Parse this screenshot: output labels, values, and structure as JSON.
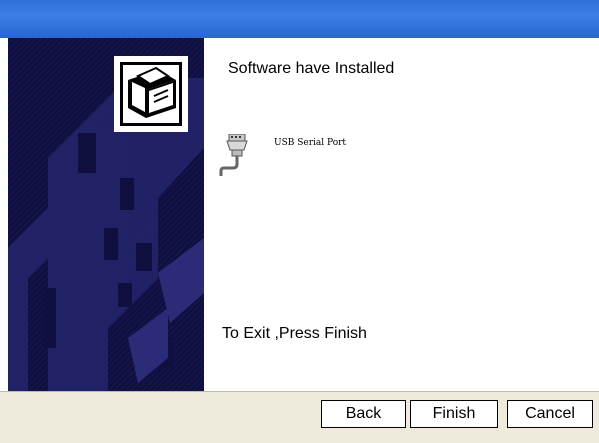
{
  "wizard": {
    "heading": "Software have Installed",
    "device_label": "USB Serial Port",
    "exit_text": "To Exit ,Press Finish"
  },
  "icons": {
    "wizard_logo": "installer-box-icon",
    "device": "serial-port-connector-icon"
  },
  "buttons": {
    "back": "Back",
    "finish": "Finish",
    "cancel": "Cancel"
  },
  "colors": {
    "title_bar": "#2f6fd8",
    "left_panel": "#0d0d3c",
    "button_bar": "#efebdc"
  }
}
